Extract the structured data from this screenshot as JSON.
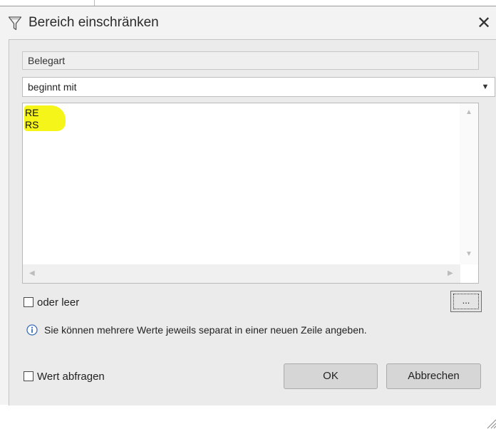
{
  "dialog": {
    "title": "Bereich einschränken",
    "title_icon": "filter-icon",
    "close_glyph": "✕",
    "field_name": "Belegart",
    "operator": {
      "selected": "beginnt mit",
      "arrow_glyph": "▼"
    },
    "values": [
      "RE",
      "RS"
    ],
    "highlight_color": "#f5f51a",
    "scrollbar": {
      "up": "▲",
      "down": "▼",
      "left": "◀",
      "right": "▶"
    },
    "or_empty_label": "oder leer",
    "browse_label": "...",
    "info_icon": "info-icon",
    "info_text": "Sie können mehrere Werte jeweils separat in einer neuen Zeile angeben.",
    "ask_value_label": "Wert abfragen",
    "ok_label": "OK",
    "cancel_label": "Abbrechen"
  }
}
